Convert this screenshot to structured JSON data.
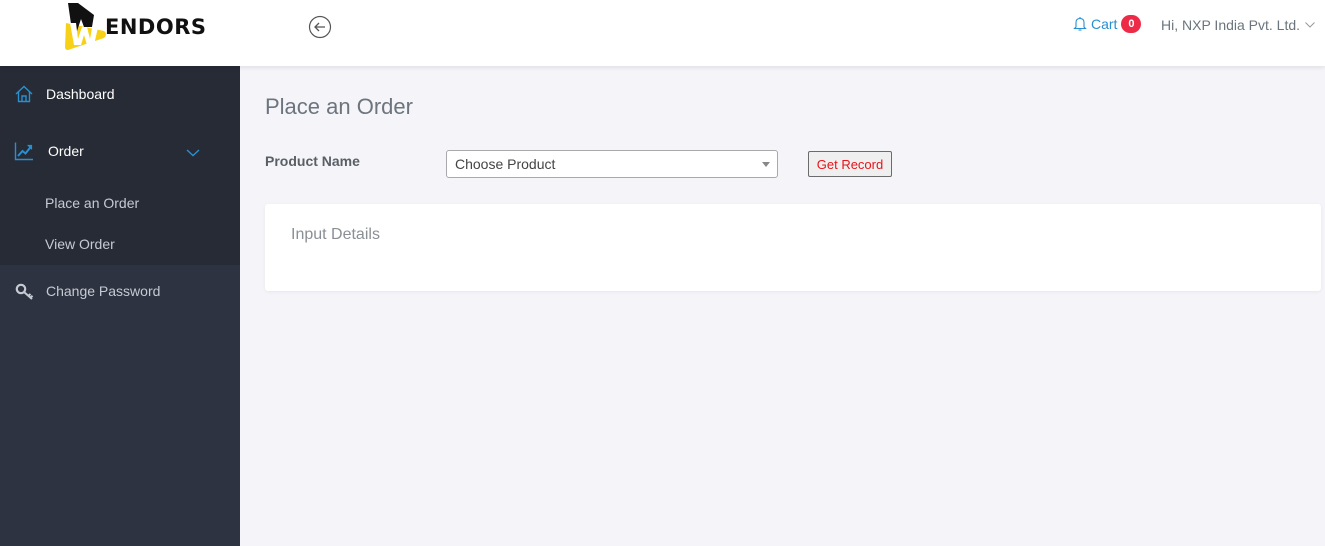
{
  "header": {
    "logo_text": "ENDORS",
    "logo_letter": "W",
    "cart_label": "Cart",
    "cart_count": "0",
    "user_greeting": "Hi, NXP India Pvt. Ltd."
  },
  "sidebar": {
    "items": [
      {
        "label": "Dashboard",
        "icon": "home-icon"
      },
      {
        "label": "Order",
        "icon": "chart-line-icon",
        "expanded": true,
        "children": [
          {
            "label": "Place an Order"
          },
          {
            "label": "View Order"
          }
        ]
      },
      {
        "label": "Change Password",
        "icon": "key-icon"
      }
    ]
  },
  "main": {
    "page_title": "Place an Order",
    "product_label": "Product Name",
    "product_select_value": "Choose Product",
    "get_record_label": "Get Record",
    "card_title": "Input Details"
  },
  "colors": {
    "sidebar_bg": "#2d3340",
    "sidebar_active_bg": "#262b35",
    "accent_blue": "#2a8fd1",
    "badge_red": "#ee2b47",
    "logo_yellow": "#f7d117",
    "button_text_red": "#e8141a",
    "page_bg": "#f4f4f9"
  }
}
